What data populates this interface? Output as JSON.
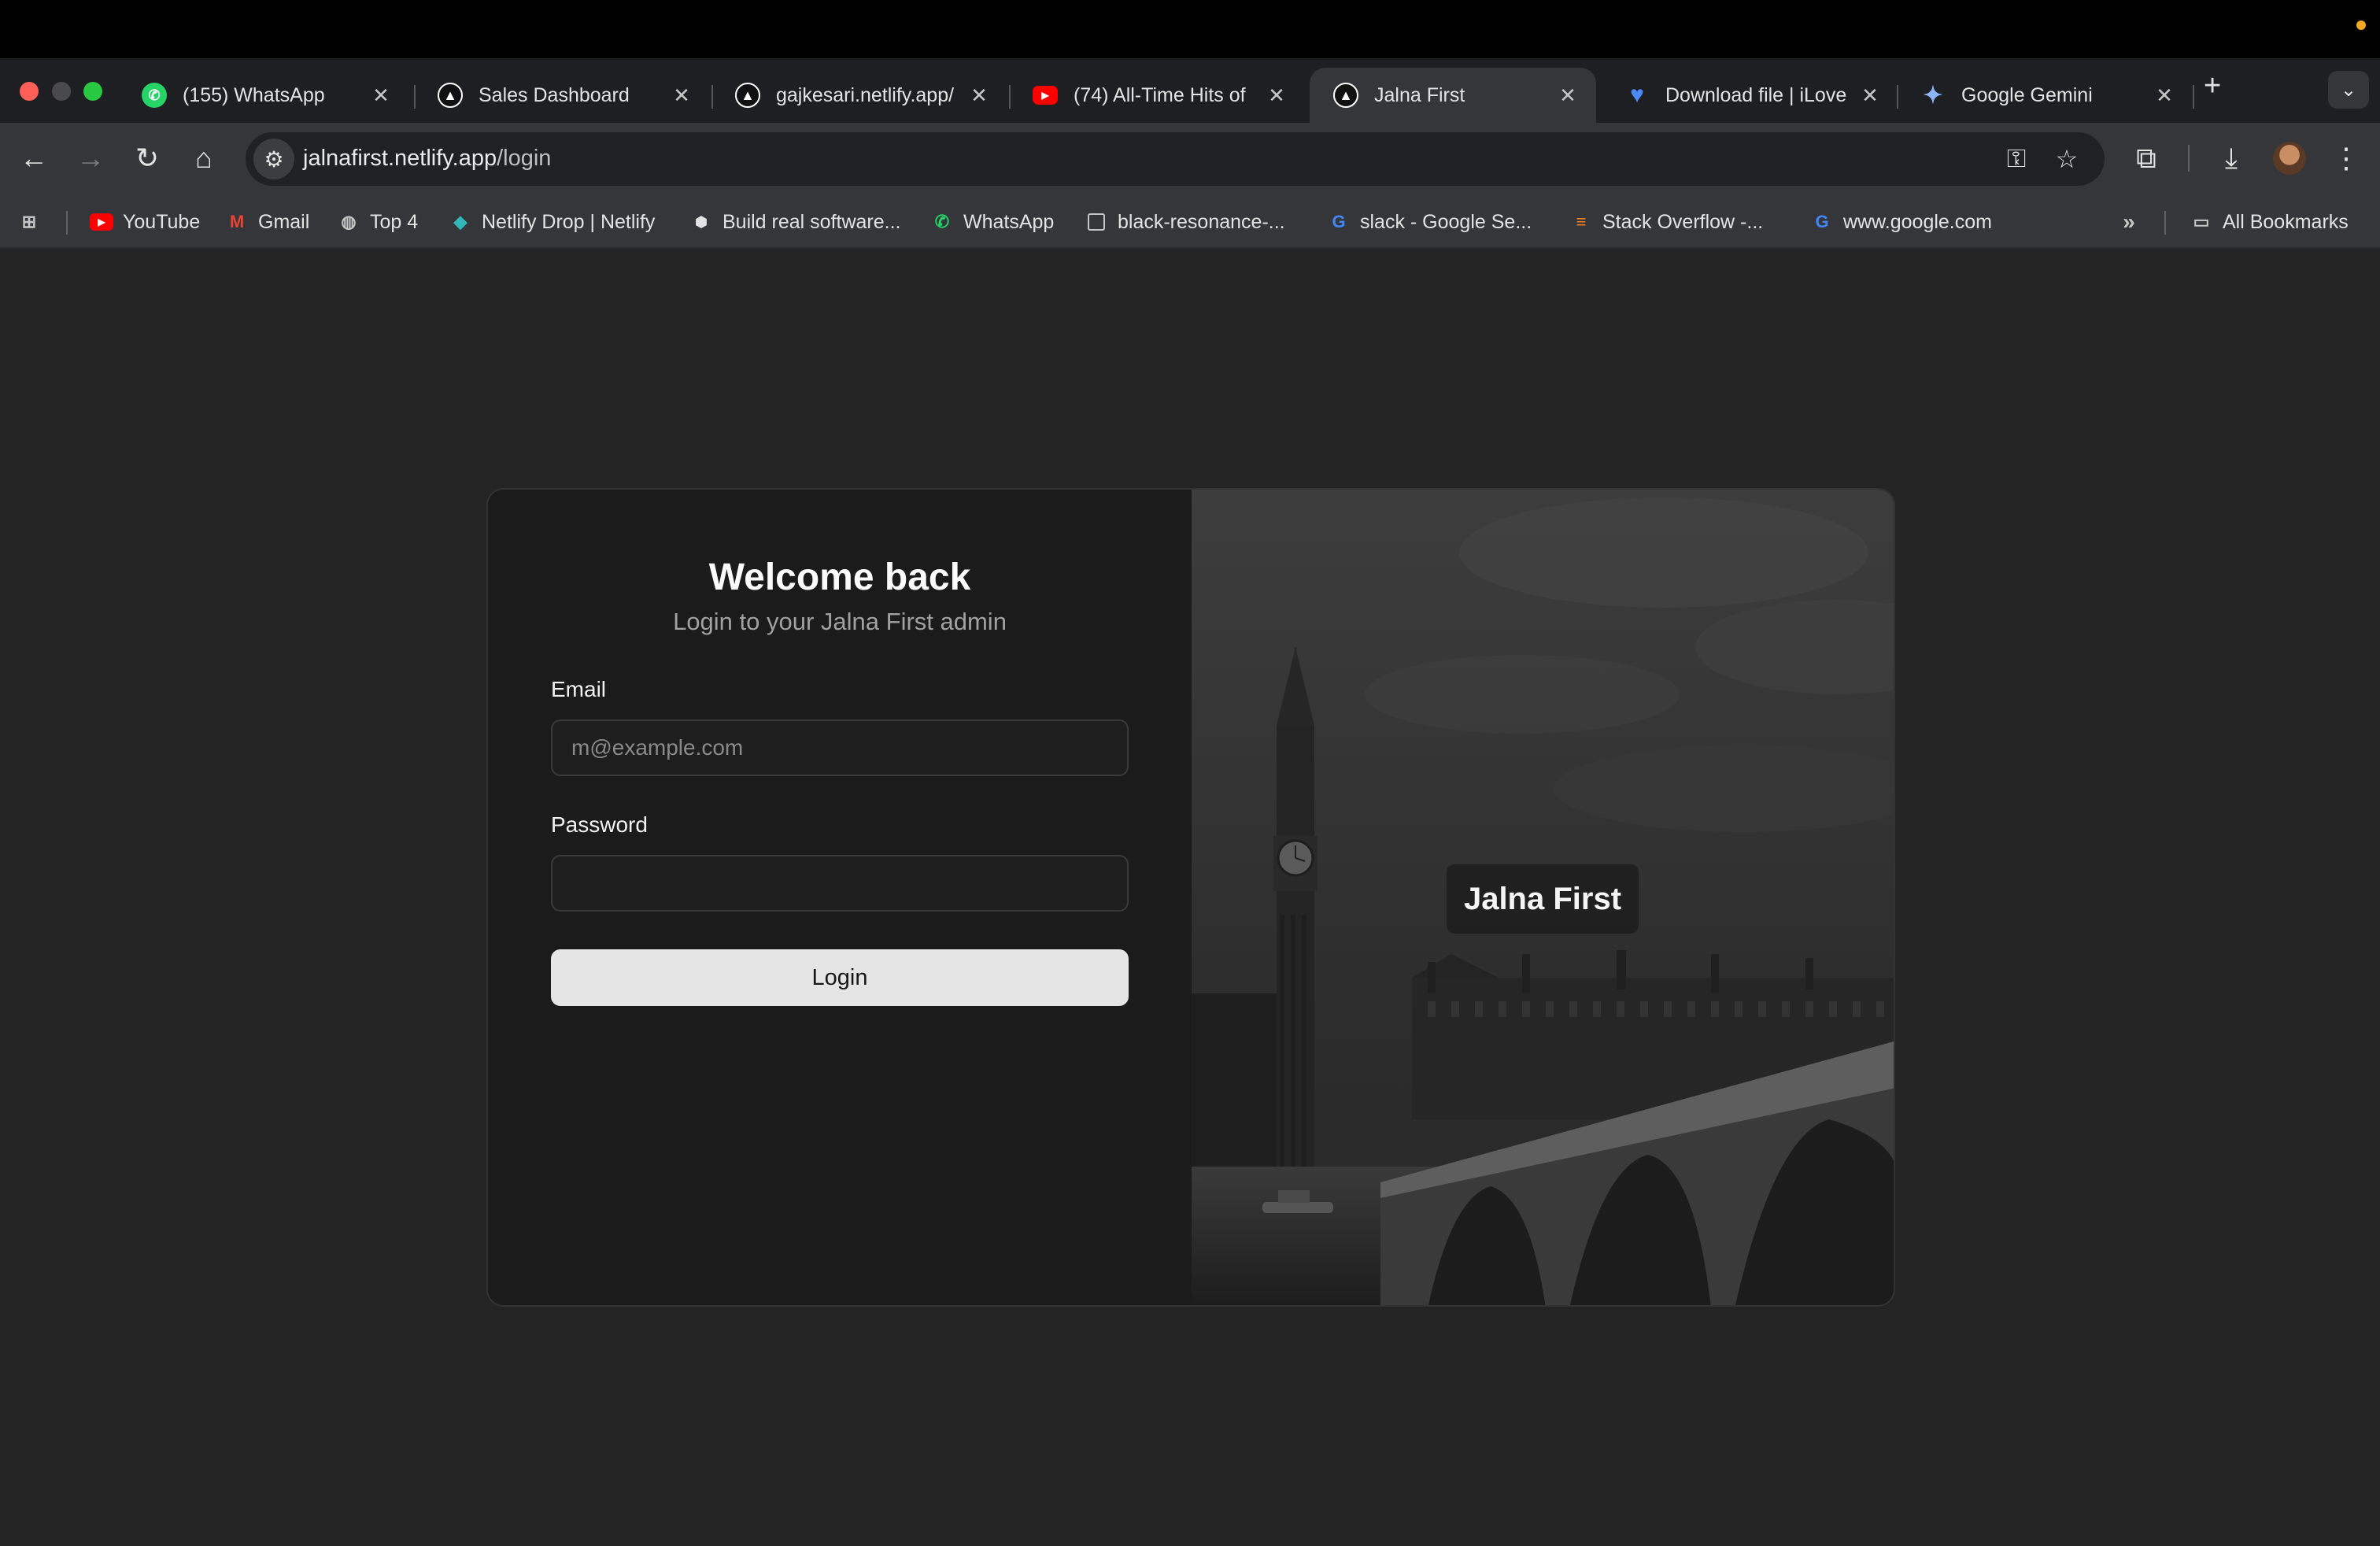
{
  "browser": {
    "tabs": [
      {
        "title": "(155) WhatsApp",
        "favicon": "whatsapp-icon"
      },
      {
        "title": "Sales Dashboard",
        "favicon": "netlify-triangle-icon"
      },
      {
        "title": "gajkesari.netlify.app/",
        "favicon": "netlify-triangle-icon"
      },
      {
        "title": "(74) All-Time Hits of",
        "favicon": "youtube-icon"
      },
      {
        "title": "Jalna First",
        "favicon": "netlify-triangle-icon",
        "active": true
      },
      {
        "title": "Download file | iLove",
        "favicon": "ilovepdf-heart-icon"
      },
      {
        "title": "Google Gemini",
        "favicon": "gemini-sparkle-icon"
      }
    ],
    "url_host": "jalnafirst.netlify.app",
    "url_path": "/login",
    "bookmarks": [
      {
        "label": "YouTube",
        "icon": "youtube-icon"
      },
      {
        "label": "Gmail",
        "icon": "gmail-icon"
      },
      {
        "label": "Top 4",
        "icon": "globe-icon"
      },
      {
        "label": "Netlify Drop | Netlify",
        "icon": "netlify-diamond-icon"
      },
      {
        "label": "Build real software...",
        "icon": "cube-icon"
      },
      {
        "label": "WhatsApp",
        "icon": "whatsapp-icon"
      },
      {
        "label": "black-resonance-...",
        "icon": "square-icon"
      },
      {
        "label": "slack - Google Se...",
        "icon": "google-icon"
      },
      {
        "label": "Stack Overflow -...",
        "icon": "stackoverflow-icon"
      },
      {
        "label": "www.google.com",
        "icon": "google-icon"
      }
    ],
    "all_bookmarks_label": "All Bookmarks"
  },
  "login": {
    "title": "Welcome back",
    "subtitle": "Login to your Jalna First admin",
    "email_label": "Email",
    "email_placeholder": "m@example.com",
    "email_value": "",
    "password_label": "Password",
    "password_value": "",
    "button_label": "Login"
  },
  "hero": {
    "brand": "Jalna First"
  },
  "colors": {
    "page_bg": "#242424",
    "card_bg": "#1b1b1b",
    "button_bg": "#e5e5e5",
    "chrome_toolbar": "#35363a"
  }
}
